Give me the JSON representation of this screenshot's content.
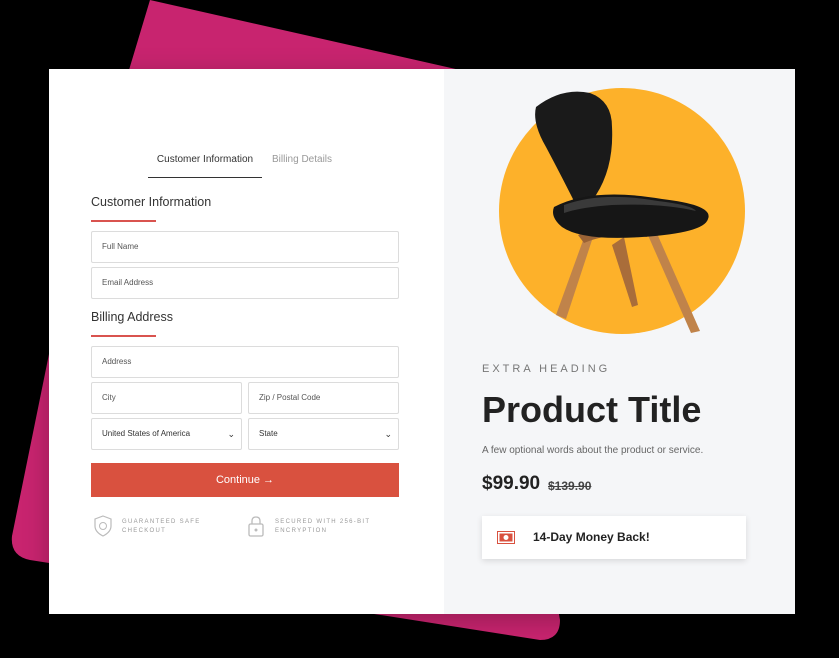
{
  "colors": {
    "accent": "#d9513f",
    "brand_pink": "#c8246f",
    "circle": "#fdb12a",
    "panel_bg": "#f5f6f8"
  },
  "tabs": [
    {
      "label": "Customer Information",
      "active": true
    },
    {
      "label": "Billing Details",
      "active": false
    }
  ],
  "customer": {
    "title": "Customer Information",
    "full_name_placeholder": "Full Name",
    "email_placeholder": "Email Address"
  },
  "billing": {
    "title": "Billing Address",
    "address_placeholder": "Address",
    "city_placeholder": "City",
    "zip_placeholder": "Zip / Postal Code",
    "country_selected": "United States of America",
    "state_selected": "State"
  },
  "continue_label": "Continue →",
  "badges": [
    {
      "icon": "shield-icon",
      "text": "GUARANTEED SAFE CHECKOUT"
    },
    {
      "icon": "lock-icon",
      "text": "SECURED WITH 256-BIT ENCRYPTION"
    }
  ],
  "product": {
    "image": "chair-image",
    "extra_heading": "EXTRA HEADING",
    "title": "Product Title",
    "description": "A few optional words about the product or service.",
    "price": "$99.90",
    "old_price": "$139.90",
    "money_back_icon": "money-bill-icon",
    "money_back": "14-Day Money Back!"
  }
}
